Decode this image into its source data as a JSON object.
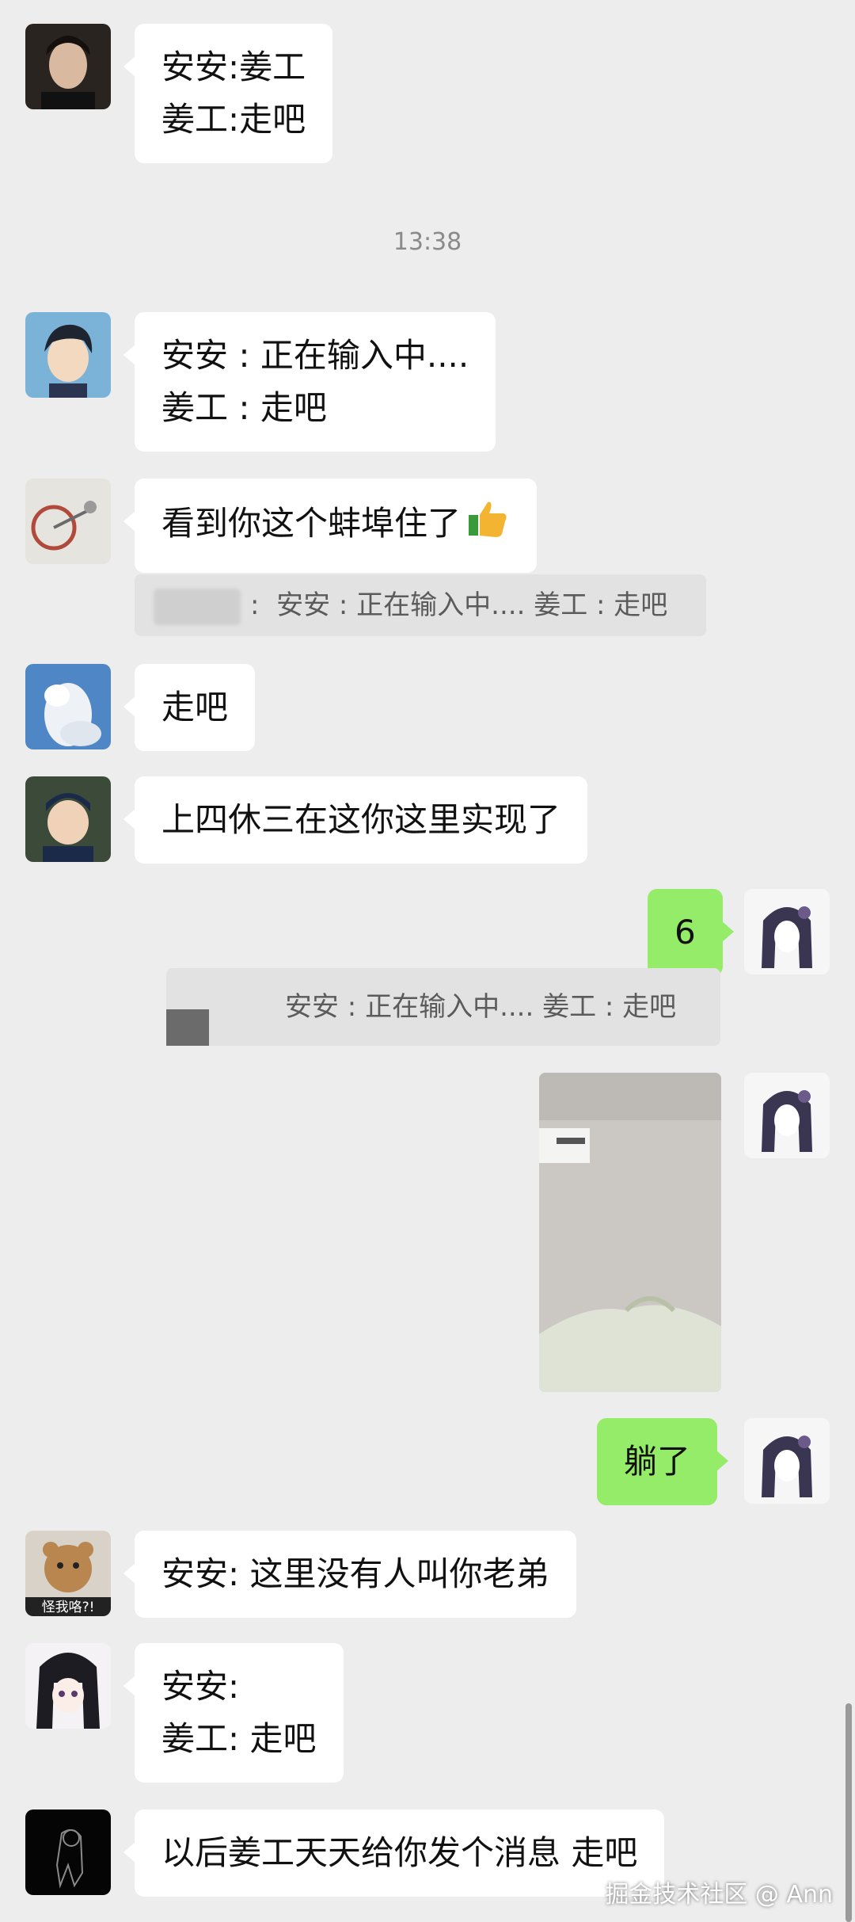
{
  "timestamp": "13:38",
  "messages": {
    "m1": {
      "line1": "安安:姜工",
      "line2": "姜工:走吧"
    },
    "m2": {
      "line1": "安安 : 正在输入中....",
      "line2": "姜工 : 走吧"
    },
    "m3": {
      "text": "看到你这个蚌埠住了",
      "quote_sep": ":",
      "quote": "安安 : 正在输入中.... 姜工 : 走吧"
    },
    "m4": {
      "text": "走吧"
    },
    "m5": {
      "text": "上四休三在这你这里实现了"
    },
    "m6": {
      "text": "6",
      "quote": "安安 : 正在输入中.... 姜工 : 走吧"
    },
    "m8": {
      "text": "躺了"
    },
    "m9": {
      "text": "安安:  这里没有人叫你老弟"
    },
    "m10": {
      "line1": "安安:",
      "line2": "姜工:  走吧"
    },
    "m11": {
      "text": "以后姜工天天给你发个消息  走吧"
    }
  },
  "avatar_texts": {
    "teddy_caption": "怪我咯?!"
  },
  "watermark": "掘金技术社区 @ Ann",
  "colors": {
    "background": "#ededed",
    "self_bubble": "#95ec69",
    "other_bubble": "#ffffff"
  }
}
